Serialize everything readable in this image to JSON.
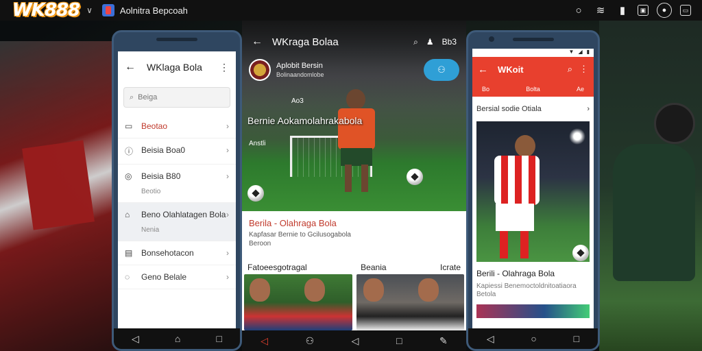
{
  "topbar": {
    "logo": "WK888",
    "app_title": "Aolnitra Bepcoah",
    "icons": [
      "chevron-down-icon",
      "chat-bubble-icon",
      "wifi-icon",
      "signal-icon",
      "image-icon",
      "record-icon",
      "window-icon"
    ]
  },
  "phone1": {
    "title": "WKlaga Bola",
    "search_placeholder": "Beiga",
    "items": [
      {
        "label": "Beotao",
        "sub": ""
      },
      {
        "label": "Beisia Boa0",
        "sub": ""
      },
      {
        "label": "Beisia B80",
        "sub": "Beotio"
      },
      {
        "label": "Beno Olahlatagen Bola",
        "sub": "Nenia"
      },
      {
        "label": "Bonsehotacon",
        "sub": ""
      },
      {
        "label": "Geno Belale",
        "sub": ""
      }
    ]
  },
  "middle": {
    "title": "WKraga Bolaa",
    "header_action": "Bb3",
    "brand_title": "Aplobit Bersin",
    "brand_sub": "Bolinaandomlobe",
    "pill_icon": "people-icon",
    "hero_small": "Ao3",
    "hero_caption": "Bernie Aokamolahrakabola",
    "hero_small2": "Anstli",
    "card_title": "Berila - Olahraga Bola",
    "card_desc_1": "Kapfasar Bernie to Gcilusogabola",
    "card_desc_2": "Beroon",
    "tabs": [
      "Fatoeesgotragal",
      "Beania",
      "Icrate"
    ]
  },
  "phone3": {
    "title": "WKoit",
    "tabs": [
      "Bo",
      "Bolta",
      "Ae"
    ],
    "section_title": "Bersial sodie Otiala",
    "article_title": "Berili - Olahraga Bola",
    "article_desc_1": "Kapiessi Benemoctoldnitoatiaora",
    "article_desc_2": "Betola"
  },
  "colors": {
    "accent_red": "#e8402e",
    "pill_blue": "#2f9fd6",
    "logo_orange": "#f29a1a"
  }
}
